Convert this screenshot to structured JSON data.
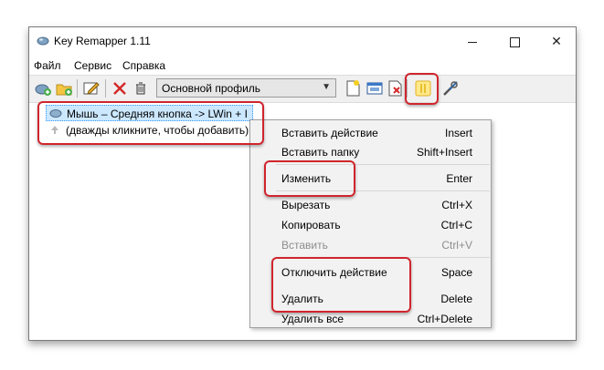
{
  "window": {
    "title": "Key Remapper 1.11",
    "controls": {
      "minimize": "minimize",
      "maximize": "maximize",
      "close": "✕"
    }
  },
  "menu": [
    "Файл",
    "Сервис",
    "Справка"
  ],
  "toolbar": {
    "profile_value": "Основной профиль",
    "icons": [
      "add-action-icon",
      "add-folder-icon",
      "edit-icon",
      "delete-icon",
      "trash-icon",
      "new-profile-icon",
      "profile-window-icon",
      "profile-delete-icon",
      "pause-icon",
      "settings-icon"
    ]
  },
  "tree": {
    "items": [
      {
        "label": "Мышь – Средняя кнопка -> LWin + I"
      },
      {
        "label": "(дважды кликните, чтобы добавить)"
      }
    ]
  },
  "context_menu": {
    "items": [
      {
        "label": "Вставить действие",
        "shortcut": "Insert",
        "enabled": true
      },
      {
        "label": "Вставить папку",
        "shortcut": "Shift+Insert",
        "enabled": true
      },
      {
        "label": "Изменить",
        "shortcut": "Enter",
        "enabled": true
      },
      {
        "label": "Вырезать",
        "shortcut": "Ctrl+X",
        "enabled": true
      },
      {
        "label": "Копировать",
        "shortcut": "Ctrl+C",
        "enabled": true
      },
      {
        "label": "Вставить",
        "shortcut": "Ctrl+V",
        "enabled": false
      },
      {
        "label": "Отключить действие",
        "shortcut": "Space",
        "enabled": true
      },
      {
        "label": "Удалить",
        "shortcut": "Delete",
        "enabled": true
      },
      {
        "label": "Удалить все",
        "shortcut": "Ctrl+Delete",
        "enabled": true
      }
    ]
  },
  "colors": {
    "highlight": "#d0252d",
    "selection": "#cce8ff",
    "toolbar": "#f0f0f0",
    "menu_bg": "#f2f2f2"
  }
}
